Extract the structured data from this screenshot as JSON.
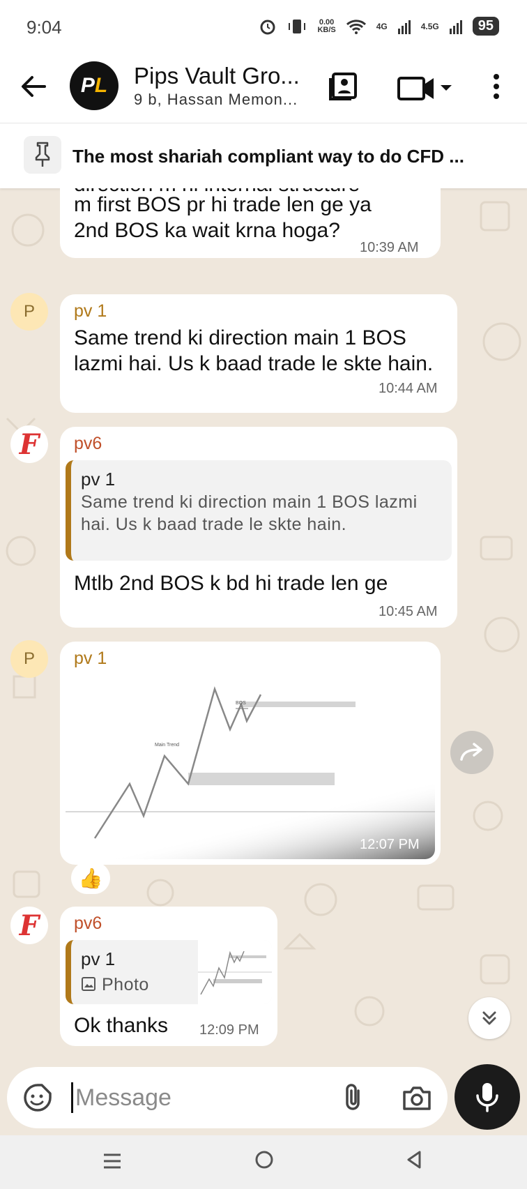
{
  "status_bar": {
    "time": "9:04",
    "net_speed_value": "0.00",
    "net_speed_unit": "KB/S",
    "network_1": "4G",
    "network_2": "4.5G",
    "battery": "95"
  },
  "header": {
    "avatar_text_a": "P",
    "avatar_text_b": "L",
    "title": "Pips Vault Gro...",
    "subtitle": "9 b, Hassan Memon..."
  },
  "pinned": {
    "text": "The most shariah compliant way to do CFD ..."
  },
  "messages": [
    {
      "text_line1": "direction m hi internal structure",
      "text_line2": "m first BOS pr hi trade len ge ya",
      "text_line3": "2nd BOS ka wait krna hoga?",
      "time": "10:39 AM"
    },
    {
      "avatar": "P",
      "sender": "pv 1",
      "text": "Same trend ki direction main 1 BOS lazmi hai. Us k baad trade le skte hain.",
      "time": "10:44 AM"
    },
    {
      "avatar": "F",
      "sender": "pv6",
      "quote_sender": "pv 1",
      "quote_text": "Same trend ki direction main 1 BOS lazmi hai. Us k baad trade le skte hain.",
      "text": "Mtlb 2nd BOS k bd hi trade len ge",
      "time": "10:45 AM"
    },
    {
      "avatar": "P",
      "sender": "pv 1",
      "image_label_main": "Main Trend",
      "image_label_bos": "BOS",
      "time": "12:07 PM",
      "reaction": "👍"
    },
    {
      "avatar": "F",
      "sender": "pv6",
      "quote_sender": "pv 1",
      "quote_text": "Photo",
      "text": "Ok thanks",
      "time": "12:09 PM"
    }
  ],
  "input": {
    "placeholder": "Message"
  },
  "colors": {
    "chat_background": "#efe7dc",
    "sender_pv1": "#b0791a",
    "sender_pv6": "#c0502a",
    "mic_button": "#1b1b1b"
  }
}
